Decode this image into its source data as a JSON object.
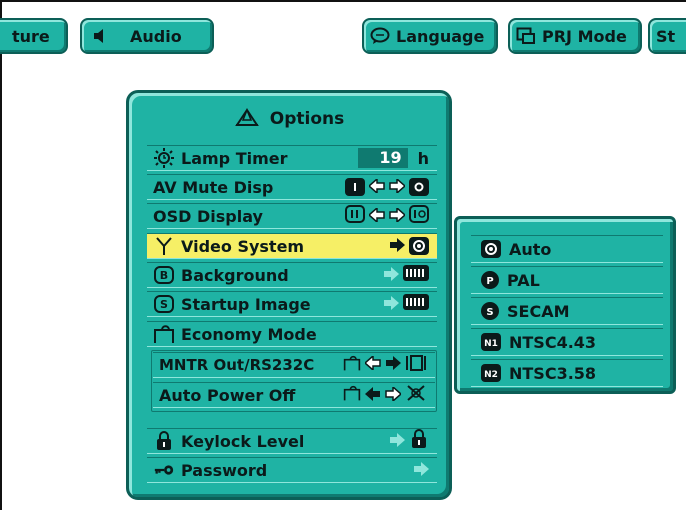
{
  "top_menu": {
    "tabs": [
      {
        "label": "ture"
      },
      {
        "label": "Audio"
      },
      {
        "label": "Language"
      },
      {
        "label": "PRJ Mode"
      },
      {
        "label": "St"
      }
    ]
  },
  "options": {
    "title": "Options",
    "items": {
      "lamp_timer": {
        "label": "Lamp Timer",
        "value": "19",
        "unit": "h"
      },
      "av_mute_disp": {
        "label": "AV Mute Disp"
      },
      "osd_display": {
        "label": "OSD Display"
      },
      "video_system": {
        "label": "Video System"
      },
      "background": {
        "label": "Background",
        "value_icon": "philips-logo"
      },
      "startup_image": {
        "label": "Startup Image",
        "value_icon": "philips-logo"
      },
      "economy_mode": {
        "label": "Economy Mode"
      },
      "mntr_out": {
        "label": "MNTR Out/RS232C"
      },
      "auto_power_off": {
        "label": "Auto Power Off"
      },
      "keylock_level": {
        "label": "Keylock Level"
      },
      "password": {
        "label": "Password"
      }
    }
  },
  "video_system_menu": {
    "options": [
      {
        "label": "Auto",
        "icon": "A"
      },
      {
        "label": "PAL",
        "icon": "P"
      },
      {
        "label": "SECAM",
        "icon": "S"
      },
      {
        "label": "NTSC4.43",
        "icon": "N1"
      },
      {
        "label": "NTSC3.58",
        "icon": "N2"
      }
    ],
    "selected": "Auto"
  },
  "colors": {
    "panel": "#1fb3a4",
    "highlight": "#f6ef66",
    "text": "#0b1a1a"
  }
}
